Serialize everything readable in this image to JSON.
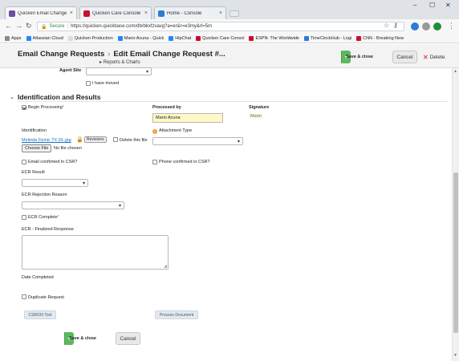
{
  "browser": {
    "tabs": [
      {
        "title": "Quicken Email Change R",
        "favicon_color": "#6b4fa1"
      },
      {
        "title": "Quicken Care Console",
        "favicon_color": "#c8102e"
      },
      {
        "title": "Home - Console",
        "favicon_color": "#2f7bd6"
      }
    ],
    "url_secure_label": "Secure",
    "url": "https://quicken.quickbase.com/db/bkxfzvavg?a=er&r=e3my&rl=5m",
    "bookmarks": [
      {
        "label": "Apps",
        "color": "#888"
      },
      {
        "label": "Atlassian Cloud",
        "color": "#2684ff"
      },
      {
        "label": "Quicken Production",
        "color": "#e8e8e8"
      },
      {
        "label": "Mario Acuna - Quick",
        "color": "#2684ff"
      },
      {
        "label": "HipChat",
        "color": "#2684ff"
      },
      {
        "label": "Quicken Care Consol",
        "color": "#c8102e"
      },
      {
        "label": "ESPN: The Worldwide",
        "color": "#c8102e"
      },
      {
        "label": "TimeClockHub - Logi",
        "color": "#2f7bd6"
      },
      {
        "label": "CNN - Breaking New",
        "color": "#c8102e"
      }
    ]
  },
  "header": {
    "crumb_parent": "Email Change Requests",
    "crumb_current": "Edit Email Change Request #...",
    "subnav": "Reports & Charts",
    "save_close_label": "Save & close",
    "cancel_label": "Cancel",
    "delete_label": "Delete"
  },
  "form": {
    "agent_site_label": "Agent Site",
    "i_have_moved_label": "I have moved",
    "section_title": "Identification and Results",
    "begin_processing_label": "Begin Processing",
    "processed_by_label": "Processed by",
    "processed_by_value": "Mario Acuna",
    "signature_label": "Signature",
    "signature_value": "Mario",
    "identification_label": "Identification",
    "file_link": "Melinda Dzinic TX DL.jpg",
    "revisions_label": "Revisions",
    "delete_file_label": "Delete this file",
    "choose_file_label": "Choose File",
    "no_file_label": "No file chosen",
    "attachment_type_label": "Attachment Type",
    "email_confirmed_label": "Email confirmed in CSR?",
    "phone_confirmed_label": "Phone confirmed in CSR?",
    "ecr_result_label": "ECR Result",
    "ecr_rejection_label": "ECR Rejection Reason",
    "ecr_complete_label": "ECR Complete",
    "ecr_finalized_label": "ECR - Finalized Response",
    "date_completed_label": "Date Completed",
    "duplicate_request_label": "Duplicate Request",
    "csr_oii_tool_label": "CSR/OII Tool",
    "process_document_label": "Process Document",
    "save_close_label": "Save & close",
    "cancel_label": "Cancel"
  },
  "colors": {
    "green": "#5cb85c",
    "required": "#d9534f",
    "link": "#1a6fbf"
  }
}
